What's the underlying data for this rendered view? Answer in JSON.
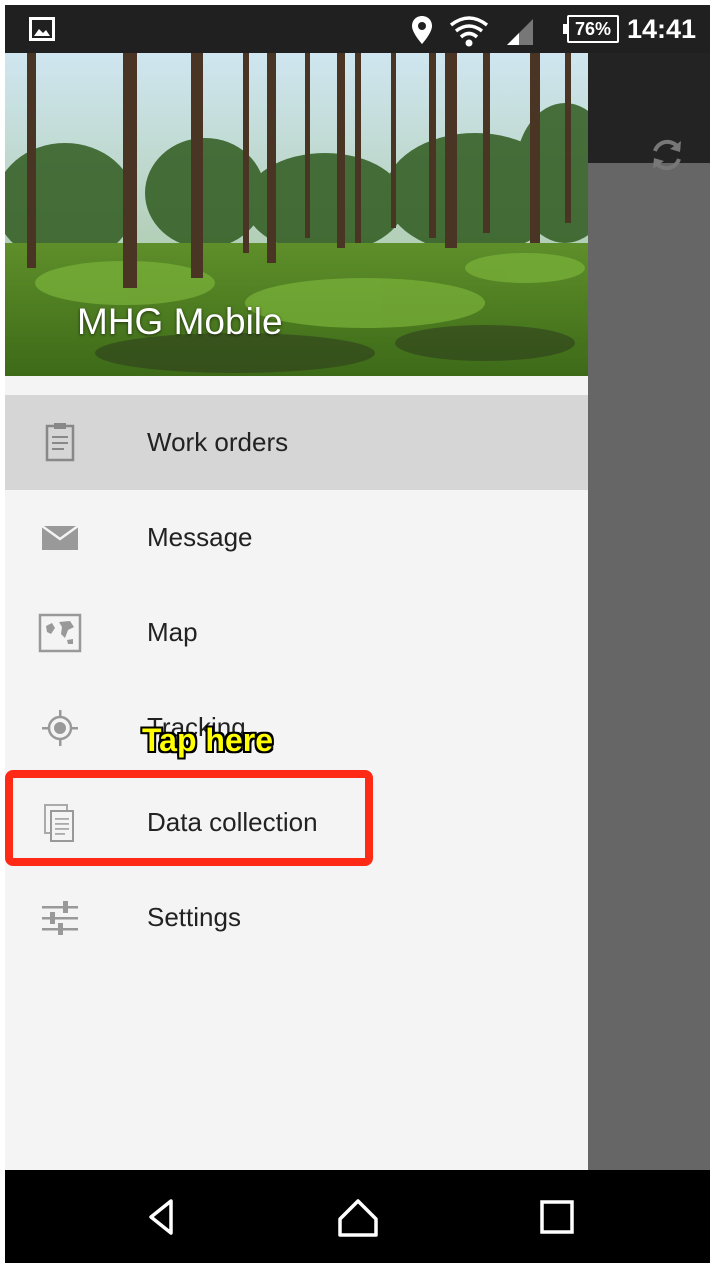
{
  "status_bar": {
    "battery": "76%",
    "time": "14:41",
    "icons": [
      "image-icon",
      "location-icon",
      "wifi-icon",
      "signal-icon"
    ]
  },
  "drawer": {
    "app_title": "MHG Mobile",
    "items": [
      {
        "label": "Work orders",
        "icon": "clipboard-icon",
        "active": true
      },
      {
        "label": "Message",
        "icon": "mail-icon"
      },
      {
        "label": "Map",
        "icon": "map-icon"
      },
      {
        "label": "Tracking",
        "icon": "crosshair-icon"
      },
      {
        "label": "Data collection",
        "icon": "documents-icon"
      },
      {
        "label": "Settings",
        "icon": "sliders-icon"
      }
    ]
  },
  "annotation": {
    "text": "Tap here",
    "color": "#ffff00",
    "box_color": "#ff2a16"
  },
  "nav_bar": {
    "icons": [
      "back-icon",
      "home-icon",
      "recents-icon"
    ]
  }
}
